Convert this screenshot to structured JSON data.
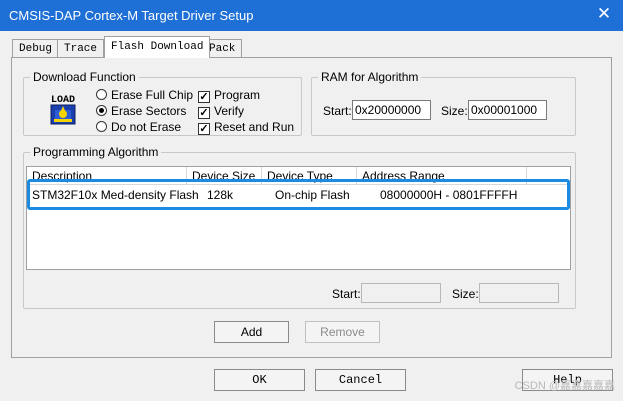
{
  "window": {
    "title": "CMSIS-DAP Cortex-M Target Driver Setup",
    "close_glyph": "✕"
  },
  "tabs": [
    {
      "label": "Debug",
      "active": false
    },
    {
      "label": "Trace",
      "active": false
    },
    {
      "label": "Flash Download",
      "active": true
    },
    {
      "label": "Pack",
      "active": false
    }
  ],
  "download_function": {
    "legend": "Download Function",
    "load_icon_text": "LOAD",
    "radios": [
      {
        "label": "Erase Full Chip",
        "selected": false
      },
      {
        "label": "Erase Sectors",
        "selected": true
      },
      {
        "label": "Do not Erase",
        "selected": false
      }
    ],
    "checks": [
      {
        "label": "Program",
        "checked": true
      },
      {
        "label": "Verify",
        "checked": true
      },
      {
        "label": "Reset and Run",
        "checked": true
      }
    ],
    "check_glyph": "✓"
  },
  "ram": {
    "legend": "RAM for Algorithm",
    "start_label": "Start:",
    "start_value": "0x20000000",
    "size_label": "Size:",
    "size_value": "0x00001000"
  },
  "programming": {
    "legend": "Programming Algorithm",
    "columns": [
      "Description",
      "Device Size",
      "Device Type",
      "Address Range"
    ],
    "rows": [
      {
        "description": "STM32F10x Med-density Flash",
        "size": "128k",
        "type": "On-chip Flash",
        "range": "08000000H - 0801FFFFH"
      }
    ],
    "start_label": "Start:",
    "start_value": "",
    "size_label": "Size:",
    "size_value": "",
    "add_label": "Add",
    "remove_label": "Remove"
  },
  "footer": {
    "ok_label": "OK",
    "cancel_label": "Cancel",
    "help_label": "Help"
  },
  "watermark": "CSDN @嘉嘉嘉嘉嘉",
  "colors": {
    "titlebar": "#1e6fd6",
    "highlight": "#1a8be0"
  }
}
